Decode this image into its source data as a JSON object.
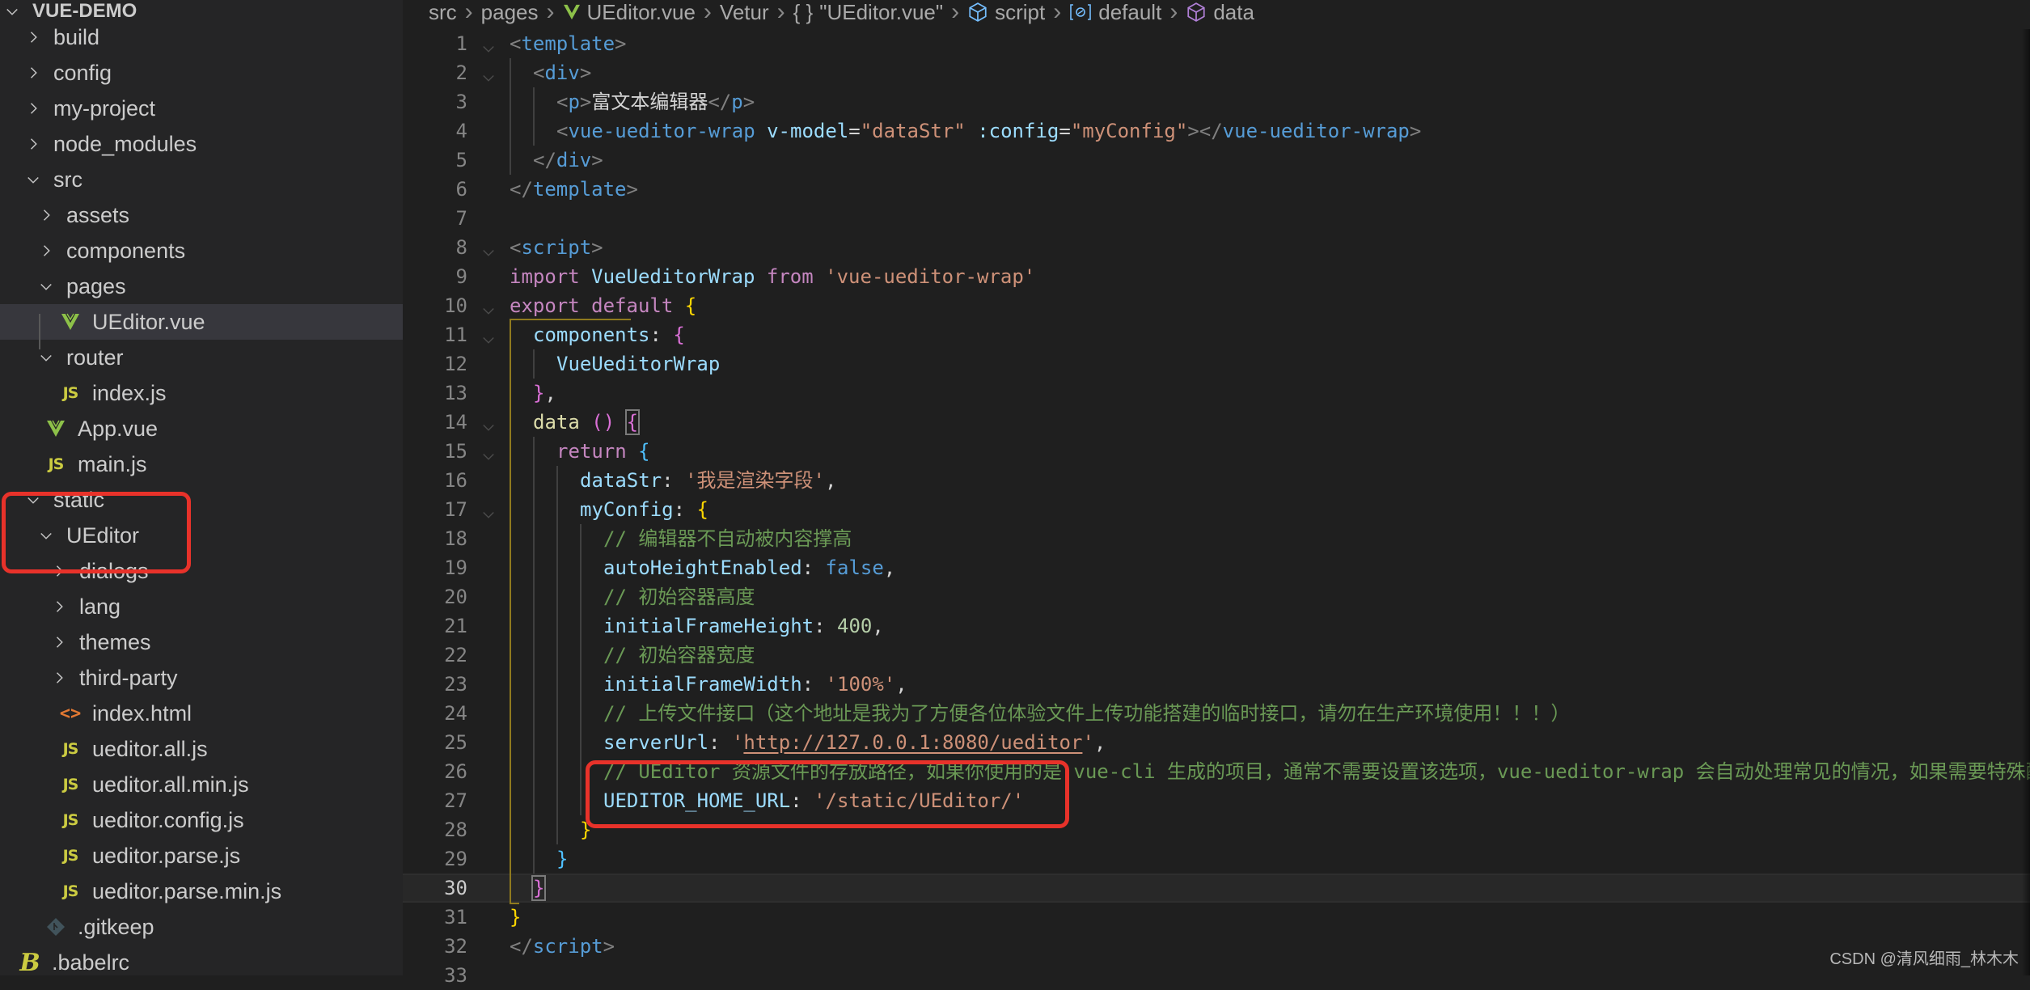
{
  "explorer": {
    "root": "VUE-DEMO",
    "items": [
      {
        "label": "build",
        "type": "folder",
        "expanded": false,
        "depth": 1
      },
      {
        "label": "config",
        "type": "folder",
        "expanded": false,
        "depth": 1
      },
      {
        "label": "my-project",
        "type": "folder",
        "expanded": false,
        "depth": 1
      },
      {
        "label": "node_modules",
        "type": "folder",
        "expanded": false,
        "depth": 1
      },
      {
        "label": "src",
        "type": "folder",
        "expanded": true,
        "depth": 1
      },
      {
        "label": "assets",
        "type": "folder",
        "expanded": false,
        "depth": 2
      },
      {
        "label": "components",
        "type": "folder",
        "expanded": false,
        "depth": 2
      },
      {
        "label": "pages",
        "type": "folder",
        "expanded": true,
        "depth": 2
      },
      {
        "label": "UEditor.vue",
        "type": "vue",
        "depth": 3,
        "selected": true
      },
      {
        "label": "router",
        "type": "folder",
        "expanded": true,
        "depth": 2
      },
      {
        "label": "index.js",
        "type": "js",
        "depth": 3
      },
      {
        "label": "App.vue",
        "type": "vue",
        "depth": 2
      },
      {
        "label": "main.js",
        "type": "js",
        "depth": 2
      },
      {
        "label": "static",
        "type": "folder",
        "expanded": true,
        "depth": 1
      },
      {
        "label": "UEditor",
        "type": "folder",
        "expanded": true,
        "depth": 2
      },
      {
        "label": "dialogs",
        "type": "folder",
        "expanded": false,
        "depth": 3
      },
      {
        "label": "lang",
        "type": "folder",
        "expanded": false,
        "depth": 3
      },
      {
        "label": "themes",
        "type": "folder",
        "expanded": false,
        "depth": 3
      },
      {
        "label": "third-party",
        "type": "folder",
        "expanded": false,
        "depth": 3
      },
      {
        "label": "index.html",
        "type": "html",
        "depth": 3
      },
      {
        "label": "ueditor.all.js",
        "type": "js",
        "depth": 3
      },
      {
        "label": "ueditor.all.min.js",
        "type": "js",
        "depth": 3
      },
      {
        "label": "ueditor.config.js",
        "type": "js",
        "depth": 3
      },
      {
        "label": "ueditor.parse.js",
        "type": "js",
        "depth": 3
      },
      {
        "label": "ueditor.parse.min.js",
        "type": "js",
        "depth": 3
      },
      {
        "label": ".gitkeep",
        "type": "git",
        "depth": 2
      },
      {
        "label": ".babelrc",
        "type": "babel",
        "depth": 1
      }
    ]
  },
  "breadcrumb": [
    {
      "label": "src",
      "icon": null
    },
    {
      "label": "pages",
      "icon": null
    },
    {
      "label": "UEditor.vue",
      "icon": "vue-icon"
    },
    {
      "label": "Vetur",
      "icon": null
    },
    {
      "label": "\"UEditor.vue\"",
      "icon": "braces-icon"
    },
    {
      "label": "script",
      "icon": "module-icon"
    },
    {
      "label": "default",
      "icon": "variable-icon"
    },
    {
      "label": "data",
      "icon": "method-icon"
    }
  ],
  "editor": {
    "current_line": 30,
    "lines": [
      {
        "n": "1",
        "fold": true,
        "indent": 0,
        "tokens": [
          [
            "t-punct",
            "<"
          ],
          [
            "t-tag",
            "template"
          ],
          [
            "t-punct",
            ">"
          ]
        ]
      },
      {
        "n": "2",
        "fold": true,
        "indent": 1,
        "tokens": [
          [
            "t-punct",
            "<"
          ],
          [
            "t-tag",
            "div"
          ],
          [
            "t-punct",
            ">"
          ]
        ]
      },
      {
        "n": "3",
        "indent": 2,
        "tokens": [
          [
            "t-punct",
            "<"
          ],
          [
            "t-tag",
            "p"
          ],
          [
            "t-punct",
            ">"
          ],
          [
            "t-text",
            "富文本编辑器"
          ],
          [
            "t-punct",
            "</"
          ],
          [
            "t-tag",
            "p"
          ],
          [
            "t-punct",
            ">"
          ]
        ]
      },
      {
        "n": "4",
        "indent": 2,
        "tokens": [
          [
            "t-punct",
            "<"
          ],
          [
            "t-tag",
            "vue-ueditor-wrap"
          ],
          [
            "t-text",
            " "
          ],
          [
            "t-attr",
            "v-model"
          ],
          [
            "t-text",
            "="
          ],
          [
            "t-str",
            "\"dataStr\""
          ],
          [
            "t-text",
            " "
          ],
          [
            "t-attr",
            ":config"
          ],
          [
            "t-text",
            "="
          ],
          [
            "t-str",
            "\"myConfig\""
          ],
          [
            "t-punct",
            "></"
          ],
          [
            "t-tag",
            "vue-ueditor-wrap"
          ],
          [
            "t-punct",
            ">"
          ]
        ]
      },
      {
        "n": "5",
        "indent": 1,
        "tokens": [
          [
            "t-punct",
            "</"
          ],
          [
            "t-tag",
            "div"
          ],
          [
            "t-punct",
            ">"
          ]
        ]
      },
      {
        "n": "6",
        "indent": 0,
        "tokens": [
          [
            "t-punct",
            "</"
          ],
          [
            "t-tag",
            "template"
          ],
          [
            "t-punct",
            ">"
          ]
        ]
      },
      {
        "n": "7",
        "indent": 0,
        "tokens": []
      },
      {
        "n": "8",
        "fold": true,
        "indent": 0,
        "tokens": [
          [
            "t-punct",
            "<"
          ],
          [
            "t-tag",
            "script"
          ],
          [
            "t-punct",
            ">"
          ]
        ]
      },
      {
        "n": "9",
        "indent": 0,
        "tokens": [
          [
            "t-kw",
            "import"
          ],
          [
            "t-text",
            " "
          ],
          [
            "t-var",
            "VueUeditorWrap"
          ],
          [
            "t-text",
            " "
          ],
          [
            "t-kw",
            "from"
          ],
          [
            "t-text",
            " "
          ],
          [
            "t-str",
            "'vue-ueditor-wrap'"
          ]
        ]
      },
      {
        "n": "10",
        "fold": true,
        "indent": 0,
        "tokens": [
          [
            "t-kw",
            "export"
          ],
          [
            "t-text",
            " "
          ],
          [
            "t-kw",
            "default"
          ],
          [
            "t-text",
            " "
          ],
          [
            "t-b1",
            "{"
          ]
        ]
      },
      {
        "n": "11",
        "fold": true,
        "indent": 1,
        "tokens": [
          [
            "t-var",
            "components"
          ],
          [
            "t-text",
            ": "
          ],
          [
            "t-b2",
            "{"
          ]
        ]
      },
      {
        "n": "12",
        "indent": 2,
        "tokens": [
          [
            "t-var",
            "VueUeditorWrap"
          ]
        ]
      },
      {
        "n": "13",
        "indent": 1,
        "tokens": [
          [
            "t-b2",
            "}"
          ],
          [
            "t-text",
            ","
          ]
        ]
      },
      {
        "n": "14",
        "fold": true,
        "indent": 1,
        "tokens": [
          [
            "t-fn",
            "data"
          ],
          [
            "t-text",
            " "
          ],
          [
            "t-b2",
            "()"
          ],
          [
            "t-text",
            " "
          ],
          [
            "t-b2 cursor-box",
            "{"
          ]
        ]
      },
      {
        "n": "15",
        "fold": true,
        "indent": 2,
        "tokens": [
          [
            "t-kw",
            "return"
          ],
          [
            "t-text",
            " "
          ],
          [
            "t-b3",
            "{"
          ]
        ]
      },
      {
        "n": "16",
        "indent": 3,
        "tokens": [
          [
            "t-var",
            "dataStr"
          ],
          [
            "t-text",
            ": "
          ],
          [
            "t-str",
            "'我是渲染字段'"
          ],
          [
            "t-text",
            ","
          ]
        ]
      },
      {
        "n": "17",
        "fold": true,
        "indent": 3,
        "tokens": [
          [
            "t-var",
            "myConfig"
          ],
          [
            "t-text",
            ": "
          ],
          [
            "t-b1",
            "{"
          ]
        ]
      },
      {
        "n": "18",
        "indent": 4,
        "tokens": [
          [
            "t-com",
            "// 编辑器不自动被内容撑高"
          ]
        ]
      },
      {
        "n": "19",
        "indent": 4,
        "tokens": [
          [
            "t-var",
            "autoHeightEnabled"
          ],
          [
            "t-text",
            ": "
          ],
          [
            "t-bool",
            "false"
          ],
          [
            "t-text",
            ","
          ]
        ]
      },
      {
        "n": "20",
        "indent": 4,
        "tokens": [
          [
            "t-com",
            "// 初始容器高度"
          ]
        ]
      },
      {
        "n": "21",
        "indent": 4,
        "tokens": [
          [
            "t-var",
            "initialFrameHeight"
          ],
          [
            "t-text",
            ": "
          ],
          [
            "t-num",
            "400"
          ],
          [
            "t-text",
            ","
          ]
        ]
      },
      {
        "n": "22",
        "indent": 4,
        "tokens": [
          [
            "t-com",
            "// 初始容器宽度"
          ]
        ]
      },
      {
        "n": "23",
        "indent": 4,
        "tokens": [
          [
            "t-var",
            "initialFrameWidth"
          ],
          [
            "t-text",
            ": "
          ],
          [
            "t-str",
            "'100%'"
          ],
          [
            "t-text",
            ","
          ]
        ]
      },
      {
        "n": "24",
        "indent": 4,
        "tokens": [
          [
            "t-com",
            "// 上传文件接口（这个地址是我为了方便各位体验文件上传功能搭建的临时接口，请勿在生产环境使用！！！）"
          ]
        ]
      },
      {
        "n": "25",
        "indent": 4,
        "tokens": [
          [
            "t-var",
            "serverUrl"
          ],
          [
            "t-text",
            ": "
          ],
          [
            "t-str",
            "'"
          ],
          [
            "t-str t-link",
            "http://127.0.0.1:8080/ueditor"
          ],
          [
            "t-str",
            "'"
          ],
          [
            "t-text",
            ","
          ]
        ]
      },
      {
        "n": "26",
        "indent": 4,
        "tokens": [
          [
            "t-com",
            "// UEditor 资源文件的存放路径，如果你使用的是 vue-cli 生成的项目，通常不需要设置该选项，vue-ueditor-wrap 会自动处理常见的情况，如果需要特殊配置"
          ]
        ]
      },
      {
        "n": "27",
        "indent": 4,
        "tokens": [
          [
            "t-var",
            "UEDITOR_HOME_URL"
          ],
          [
            "t-text",
            ": "
          ],
          [
            "t-str",
            "'/static/UEditor/'"
          ]
        ]
      },
      {
        "n": "28",
        "indent": 3,
        "tokens": [
          [
            "t-b1",
            "}"
          ]
        ]
      },
      {
        "n": "29",
        "indent": 2,
        "tokens": [
          [
            "t-b3",
            "}"
          ]
        ]
      },
      {
        "n": "30",
        "indent": 1,
        "tokens": [
          [
            "t-b2 cursor-box",
            "}"
          ]
        ]
      },
      {
        "n": "31",
        "indent": 0,
        "tokens": [
          [
            "t-b1",
            "}"
          ]
        ]
      },
      {
        "n": "32",
        "indent": 0,
        "tokens": [
          [
            "t-punct",
            "</"
          ],
          [
            "t-tag",
            "script"
          ],
          [
            "t-punct",
            ">"
          ]
        ]
      },
      {
        "n": "33",
        "indent": 0,
        "tokens": []
      }
    ]
  },
  "watermark": "CSDN @清风细雨_林木木",
  "colors": {
    "highlight_box": "#e8322a",
    "vue_green": "#8dc149",
    "js_yellow": "#cbcb41"
  }
}
